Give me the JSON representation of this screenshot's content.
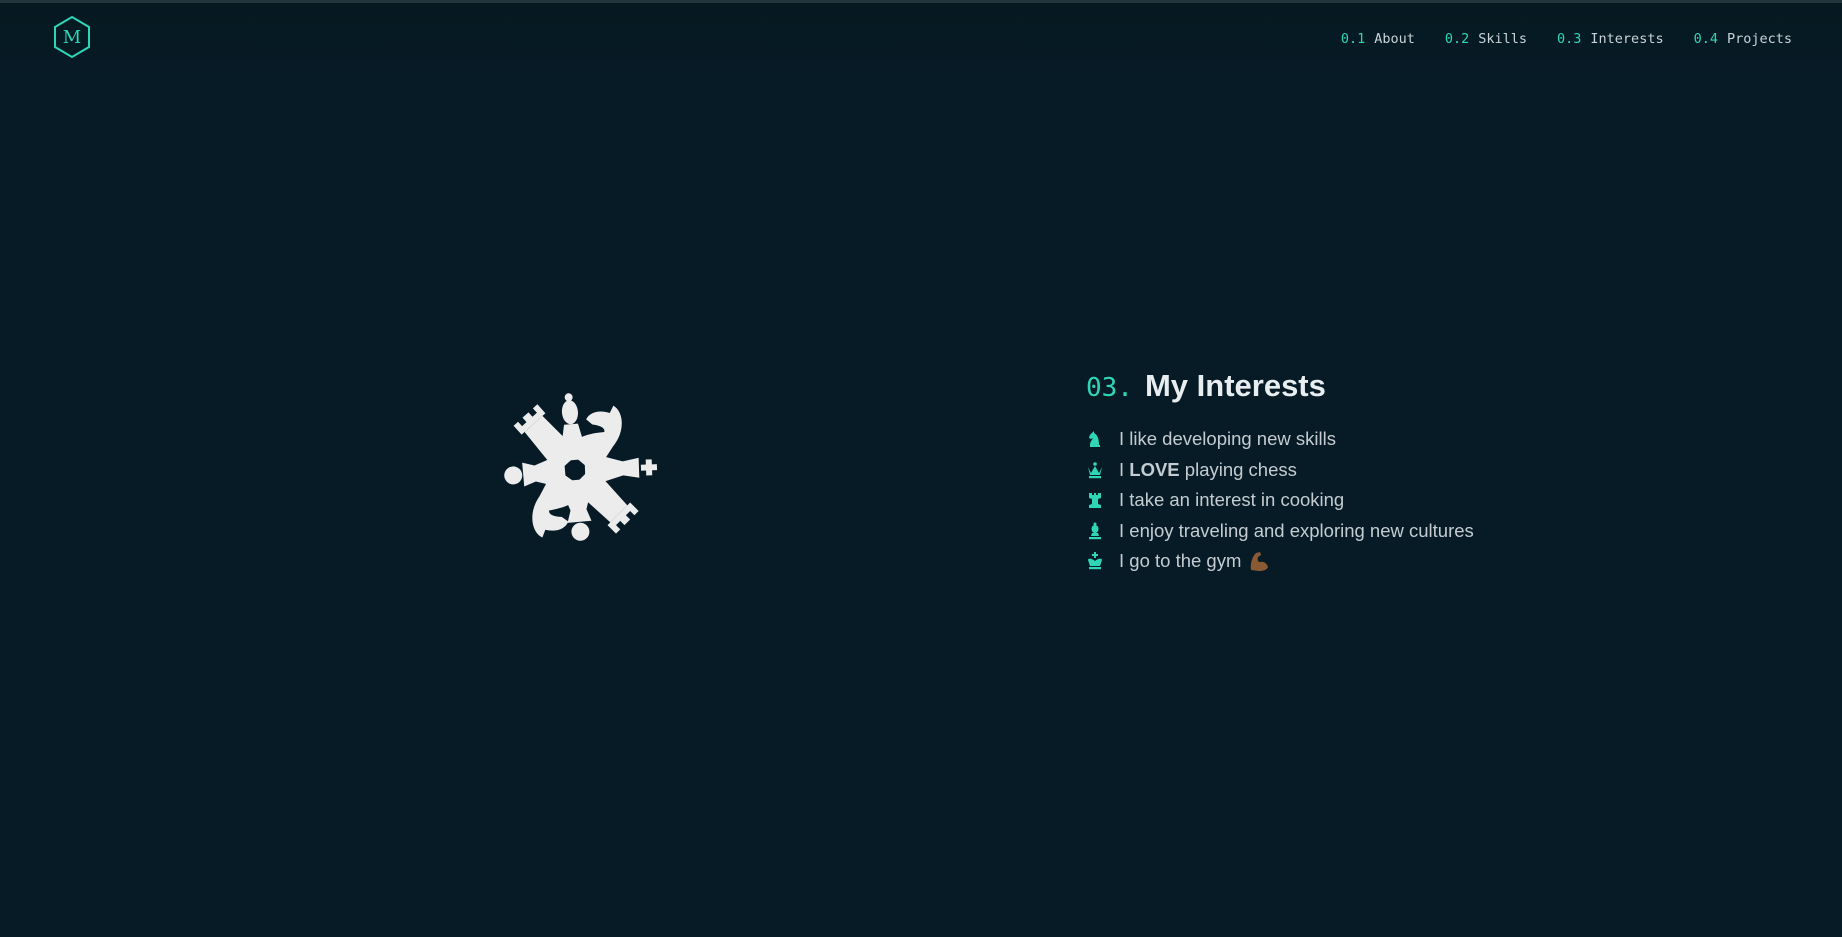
{
  "logo": {
    "letter": "M"
  },
  "nav": {
    "items": [
      {
        "num": "0.1",
        "label": "About"
      },
      {
        "num": "0.2",
        "label": "Skills"
      },
      {
        "num": "0.3",
        "label": "Interests"
      },
      {
        "num": "0.4",
        "label": "Projects"
      }
    ]
  },
  "illustration": {
    "icon": "chess-pieces-circle-icon"
  },
  "section": {
    "num": "03.",
    "title": "My Interests",
    "items": [
      {
        "icon": "chess-knight-icon",
        "text": "I like developing new skills"
      },
      {
        "icon": "chess-queen-icon",
        "pre": "I",
        "bold": "LOVE",
        "post": "playing chess"
      },
      {
        "icon": "chess-rook-icon",
        "text": "I take an interest in cooking"
      },
      {
        "icon": "chess-bishop-icon",
        "text": "I enjoy traveling and exploring new cultures"
      },
      {
        "icon": "chess-king-icon",
        "text": "I go to the gym",
        "emoji": "flexed-biceps-icon"
      }
    ]
  },
  "colors": {
    "background": "#071b26",
    "accent": "#2fd6b6",
    "text": "#c4ccd1",
    "heading": "#e8edf0"
  }
}
